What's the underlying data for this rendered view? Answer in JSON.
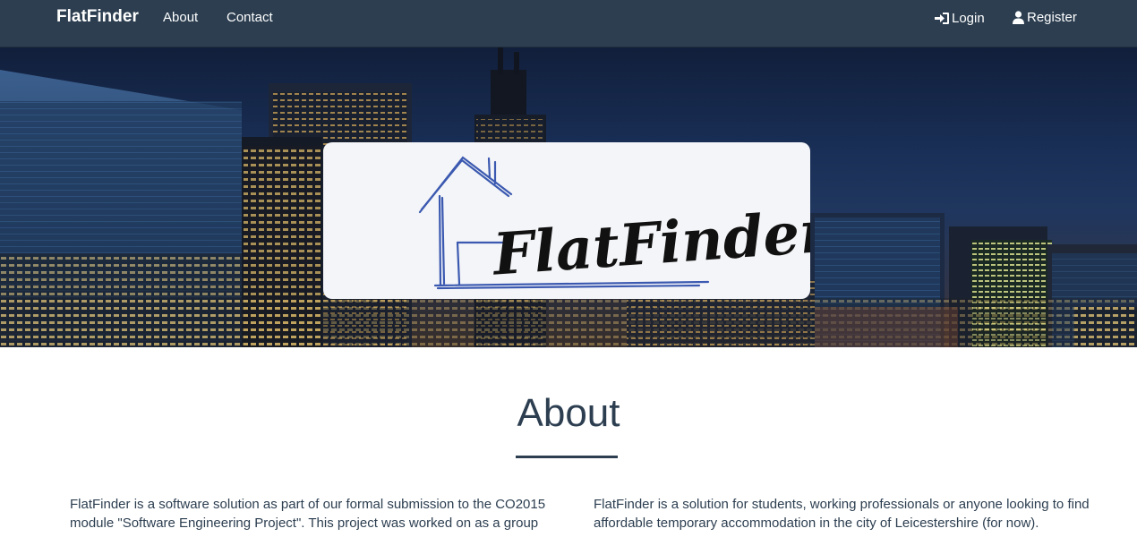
{
  "nav": {
    "brand": "FlatFinder",
    "about": "About",
    "contact": "Contact",
    "login": "Login",
    "register": "Register"
  },
  "hero": {
    "logo_text": "FlatFinder"
  },
  "about": {
    "title": "About",
    "left_text": "FlatFinder is a software solution as part of our formal submission to the CO2015 module \"Software Engineering Project\". This project was worked on as a group",
    "right_text": "FlatFinder is a solution for students, working professionals or anyone looking to find affordable temporary accommodation in the city of Leicestershire (for now)."
  },
  "colors": {
    "navbar": "#2c3e50",
    "text": "#2c3e50",
    "logo_blue": "#3b59b0"
  }
}
